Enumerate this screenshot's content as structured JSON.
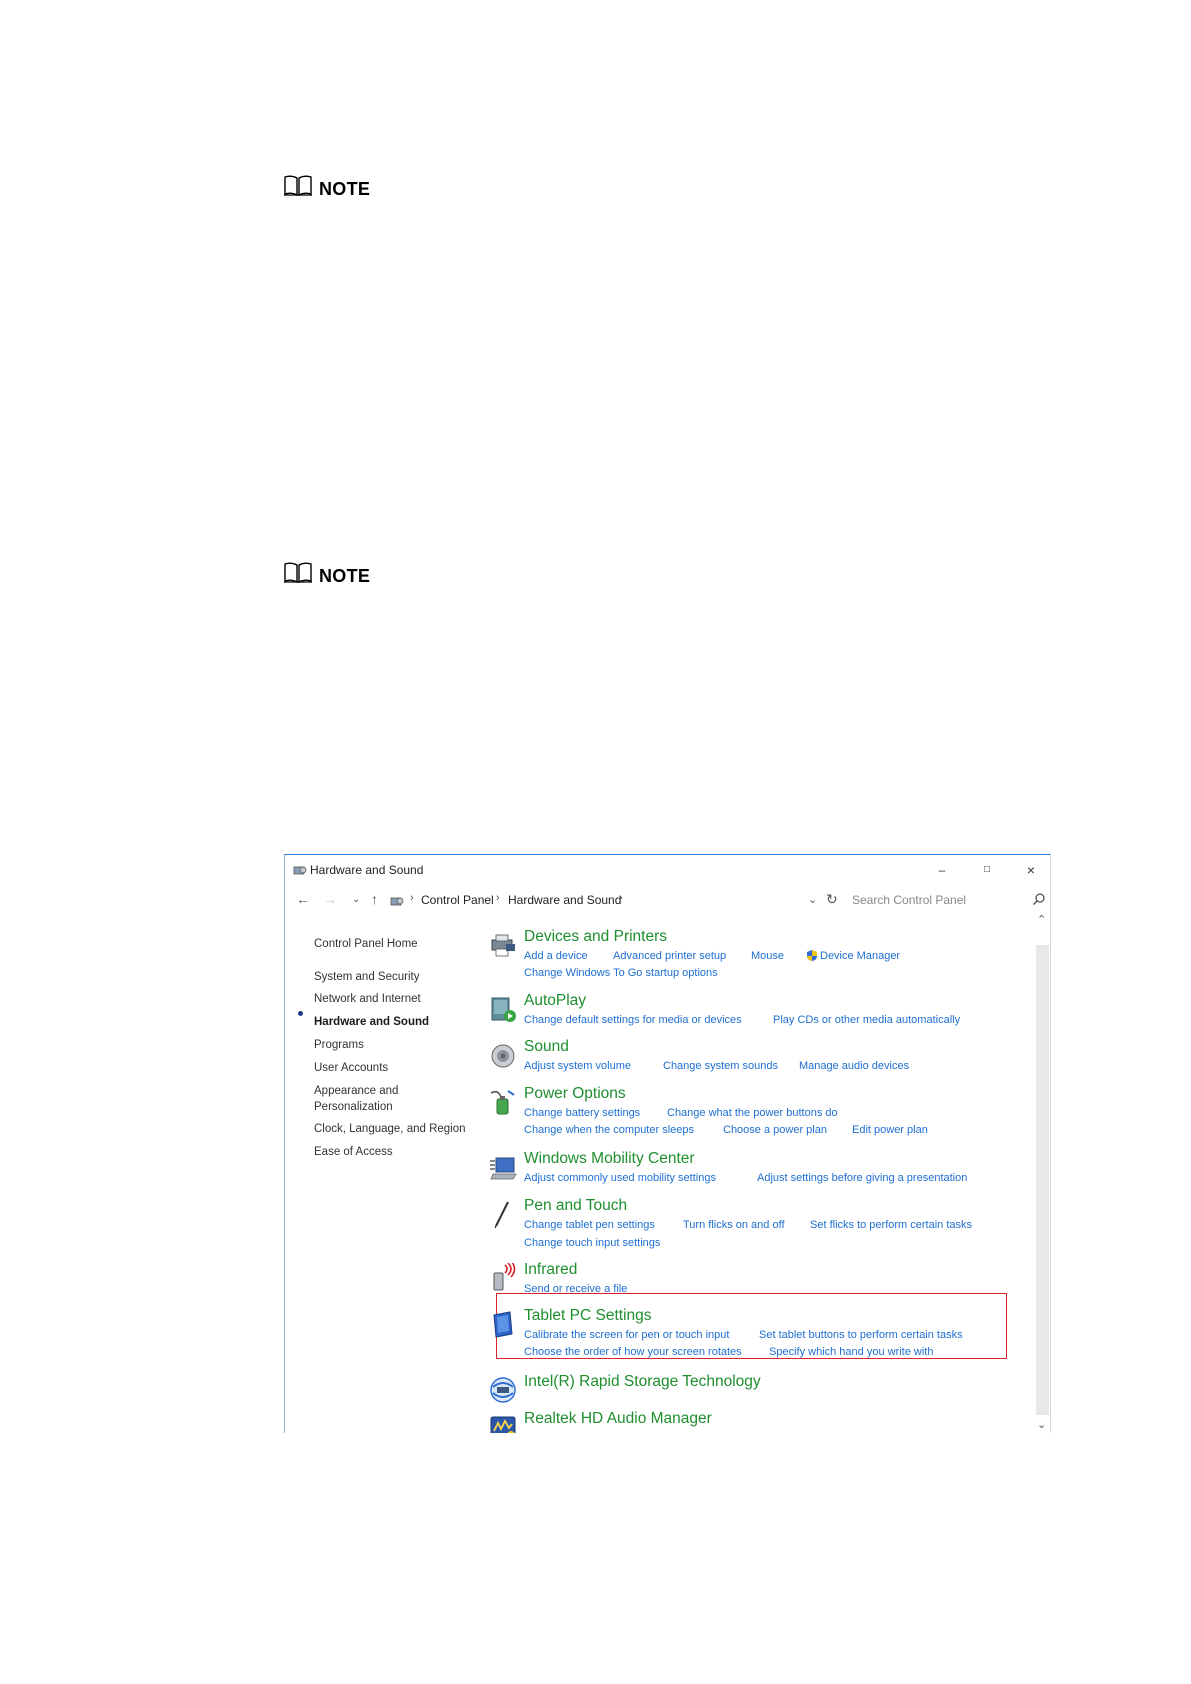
{
  "notes": [
    {
      "label": "NOTE"
    },
    {
      "label": "NOTE"
    }
  ],
  "window": {
    "title": "Hardware and Sound",
    "controls": {
      "minimize": "–",
      "maximize": "□",
      "close": "×"
    },
    "breadcrumb": [
      "Control Panel",
      "Hardware and Sound"
    ],
    "search_placeholder": "Search Control Panel"
  },
  "sidebar": {
    "items": [
      {
        "label": "Control Panel Home"
      },
      {
        "label": "System and Security"
      },
      {
        "label": "Network and Internet"
      },
      {
        "label": "Hardware and Sound",
        "active": true
      },
      {
        "label": "Programs"
      },
      {
        "label": "User Accounts"
      },
      {
        "label": "Appearance and"
      },
      {
        "label": "Personalization"
      },
      {
        "label": "Clock, Language, and Region"
      },
      {
        "label": "Ease of Access"
      }
    ]
  },
  "categories": [
    {
      "title": "Devices and Printers",
      "icon": "printer-icon",
      "links": [
        "Add a device",
        "Advanced printer setup",
        "Mouse",
        "Device Manager",
        "Change Windows To Go startup options"
      ]
    },
    {
      "title": "AutoPlay",
      "icon": "autoplay-icon",
      "links": [
        "Change default settings for media or devices",
        "Play CDs or other media automatically"
      ]
    },
    {
      "title": "Sound",
      "icon": "speaker-icon",
      "links": [
        "Adjust system volume",
        "Change system sounds",
        "Manage audio devices"
      ]
    },
    {
      "title": "Power Options",
      "icon": "power-icon",
      "links": [
        "Change battery settings",
        "Change what the power buttons do",
        "Change when the computer sleeps",
        "Choose a power plan",
        "Edit power plan"
      ]
    },
    {
      "title": "Windows Mobility Center",
      "icon": "mobility-icon",
      "links": [
        "Adjust commonly used mobility settings",
        "Adjust settings before giving a presentation"
      ]
    },
    {
      "title": "Pen and Touch",
      "icon": "pen-icon",
      "links": [
        "Change tablet pen settings",
        "Turn flicks on and off",
        "Set flicks to perform certain tasks",
        "Change touch input settings"
      ]
    },
    {
      "title": "Infrared",
      "icon": "infrared-icon",
      "links": [
        "Send or receive a file"
      ]
    },
    {
      "title": "Tablet PC Settings",
      "icon": "tablet-icon",
      "links": [
        "Calibrate the screen for pen or touch input",
        "Set tablet buttons to perform certain tasks",
        "Choose the order of how your screen rotates",
        "Specify which hand you write with"
      ]
    },
    {
      "title": "Intel(R) Rapid Storage Technology",
      "icon": "storage-icon",
      "links": []
    },
    {
      "title": "Realtek HD Audio Manager",
      "icon": "audio-manager-icon",
      "links": []
    }
  ],
  "colors": {
    "category_title": "#1e8e2e",
    "link": "#1e6fd0",
    "highlight_border": "#d9242c"
  }
}
